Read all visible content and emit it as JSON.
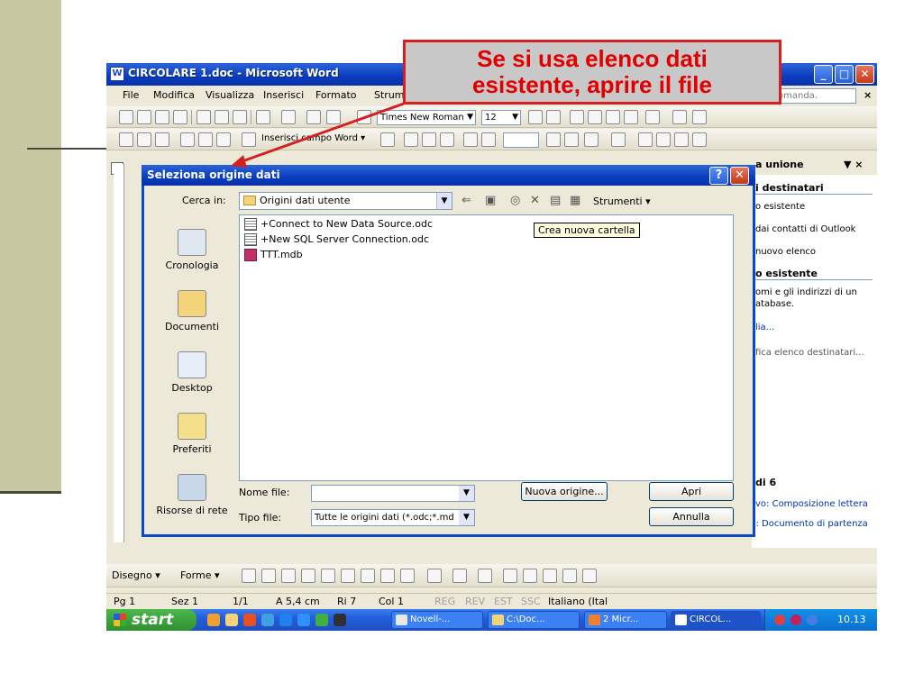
{
  "window": {
    "title": "CIRCOLARE 1.doc - Microsoft Word",
    "minimize": "_",
    "maximize": "□",
    "close": "✕"
  },
  "menu": {
    "items": [
      "File",
      "Modifica",
      "Visualizza",
      "Inserisci",
      "Formato",
      "Strumenti"
    ],
    "help_placeholder": "omanda.",
    "close_x": "×"
  },
  "toolbar": {
    "font_name": "Times New Roman",
    "font_size": "12",
    "insert_field": "Inserisci campo Word ▾"
  },
  "ruler": {
    "corner": "L"
  },
  "taskpane": {
    "title": "a unione",
    "close": "▼ ×",
    "section1": "i destinatari",
    "opt1": "o esistente",
    "opt2": "dai contatti di Outlook",
    "opt3": "nuovo elenco",
    "section2": "o esistente",
    "desc1": "omi e gli indirizzi di un",
    "desc2": "atabase.",
    "link1": "lia...",
    "gray1": "fica elenco destinatari...",
    "step": "di 6",
    "next": "vo: Composizione lettera",
    "prev": "Precedente: Documento di partenza"
  },
  "dialog": {
    "title": "Seleziona origine dati",
    "help_btn": "?",
    "close_btn": "✕",
    "look_in_label": "Cerca in:",
    "look_in_value": "Origini dati utente",
    "tools_label": "Strumenti ▾",
    "places": [
      "Cronologia",
      "Documenti",
      "Desktop",
      "Preferiti",
      "Risorse di rete"
    ],
    "files": [
      "+Connect to New Data Source.odc",
      "+New SQL Server Connection.odc",
      "TTT.mdb"
    ],
    "tooltip": "Crea nuova cartella",
    "file_name_label": "Nome file:",
    "file_name_value": "",
    "file_type_label": "Tipo file:",
    "file_type_value": "Tutte le origini dati (*.odc;*.md",
    "new_source_btn": "Nuova origine...",
    "open_btn": "Apri",
    "cancel_btn": "Annulla"
  },
  "drawbar": {
    "draw": "Disegno ▾",
    "shapes": "Forme ▾"
  },
  "status": {
    "page": "Pg 1",
    "section": "Sez 1",
    "pages": "1/1",
    "at": "A 5,4 cm",
    "line": "Ri 7",
    "col": "Col 1",
    "rec": "REG",
    "rev": "REV",
    "ext": "EST",
    "ovr": "SSC",
    "lang": "Italiano (Ital"
  },
  "taskbar": {
    "start": "start",
    "tasks": [
      "Novell-...",
      "C:\\Doc...",
      "2 Micr...",
      "CIRCOL..."
    ],
    "clock": "10.13"
  },
  "callout": {
    "line1": "Se si usa elenco dati",
    "line2": "esistente, aprire il file"
  },
  "colors": {
    "xp_blue": "#0a3cbf",
    "callout_red": "#e00000",
    "slide_bar": "#c8c8a2"
  }
}
